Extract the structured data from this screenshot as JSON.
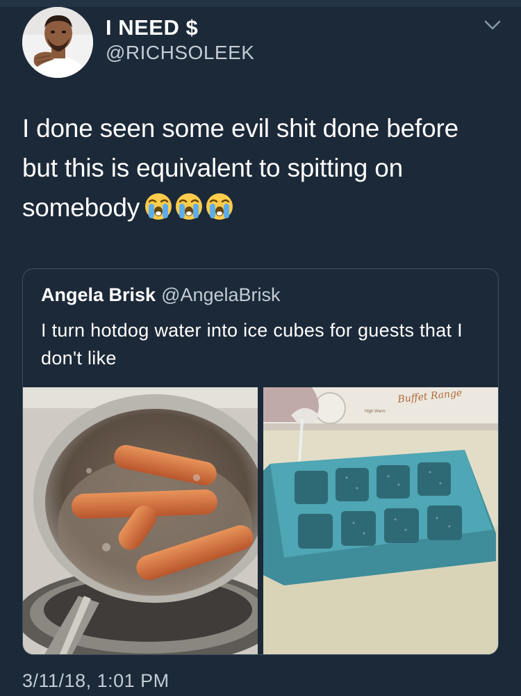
{
  "user": {
    "display_name": "I NEED $",
    "handle": "@RICHSOLEEK"
  },
  "tweet": {
    "text": "I done seen some evil shit done before but this is equivalent to spitting on somebody",
    "emojis": [
      "loudly-crying-face",
      "loudly-crying-face",
      "loudly-crying-face"
    ],
    "timestamp": "3/11/18, 1:01 PM"
  },
  "quoted_tweet": {
    "name": "Angela Brisk",
    "handle": "@AngelaBrisk",
    "text": "I turn hotdog water into ice cubes for guests that I don't like",
    "images": [
      "hotdogs-boiling-in-pot",
      "pouring-water-into-ice-tray"
    ],
    "photo_text": {
      "appliance_label": "Buffet Range",
      "dial_text": "High Warm"
    }
  },
  "icons": {
    "menu": "chevron-down-icon",
    "emoji": "loudly-crying-face-icon"
  },
  "colors": {
    "background": "#1c2938",
    "secondary_text": "#c3ccd6",
    "card_border": "#3d5164"
  }
}
